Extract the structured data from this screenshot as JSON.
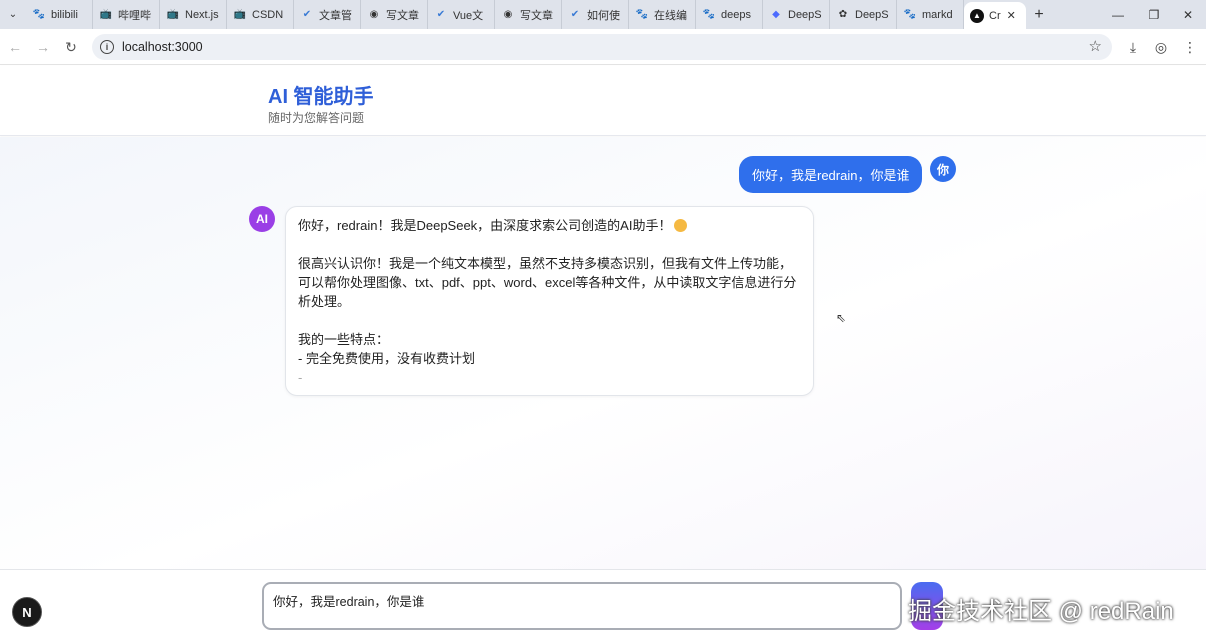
{
  "browser": {
    "tabs": [
      {
        "label": "bilibili",
        "icon": "paw-icon"
      },
      {
        "label": "哔哩哔",
        "icon": "bilibili-icon"
      },
      {
        "label": "Next.js",
        "icon": "bilibili-icon"
      },
      {
        "label": "CSDN",
        "icon": "bilibili-icon"
      },
      {
        "label": "文章管",
        "icon": "v-icon"
      },
      {
        "label": "写文章",
        "icon": "globe-icon"
      },
      {
        "label": "Vue文",
        "icon": "v-icon"
      },
      {
        "label": "写文章",
        "icon": "globe-icon"
      },
      {
        "label": "如何使",
        "icon": "v-icon"
      },
      {
        "label": "在线编",
        "icon": "paw-icon"
      },
      {
        "label": "deeps",
        "icon": "paw-icon"
      },
      {
        "label": "DeepS",
        "icon": "deepseek-icon"
      },
      {
        "label": "DeepS",
        "icon": "openai-icon"
      },
      {
        "label": "markd",
        "icon": "paw-icon"
      }
    ],
    "active_tab": {
      "label": "Cr",
      "icon": "nextjs-icon"
    },
    "url": "localhost:3000"
  },
  "app": {
    "title": "AI 智能助手",
    "subtitle": "随时为您解答问题"
  },
  "chat": {
    "user_message": "你好，我是redrain，你是谁",
    "user_avatar": "你",
    "ai_avatar": "AI",
    "ai_lines": {
      "l1": "你好，redrain！我是DeepSeek，由深度求索公司创造的AI助手！",
      "l2": "很高兴认识你！我是一个纯文本模型，虽然不支持多模态识别，但我有文件上传功能，可以帮你处理图像、txt、pdf、ppt、word、excel等各种文件，从中读取文字信息进行分析处理。",
      "l3": "我的一些特点：",
      "l4": "- 完全免费使用，没有收费计划",
      "l5": "-"
    }
  },
  "input": {
    "value": "你好，我是redrain，你是谁"
  },
  "next_badge": "N",
  "watermark": "掘金技术社区 @ redRain"
}
